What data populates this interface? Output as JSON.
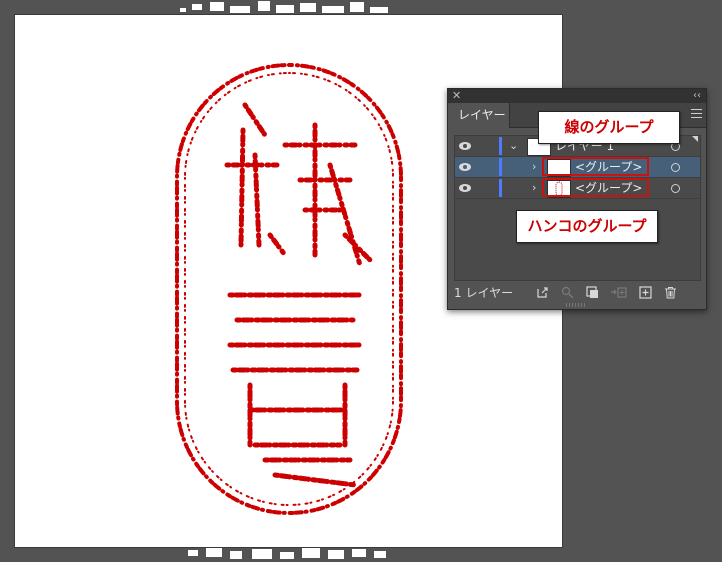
{
  "panel": {
    "close_glyph": "✕",
    "collapse_glyph": "‹‹",
    "tab_label": "レイヤー",
    "menu_icon": "menu-icon"
  },
  "layers": [
    {
      "label": "レイヤー 1",
      "expanded": true,
      "selected": false
    },
    {
      "label": "<グループ>",
      "expanded": false,
      "selected": true
    },
    {
      "label": "<グループ>",
      "expanded": false,
      "selected": false
    }
  ],
  "footer": {
    "layer_count": "1 レイヤー"
  },
  "callouts": {
    "line_group": "線のグループ",
    "hanko_group": "ハンコのグループ"
  },
  "colors": {
    "stamp_red": "#cc0000",
    "layer_color": "#4f7bff",
    "highlight": "#cc1111",
    "selected_row": "#46607a"
  }
}
